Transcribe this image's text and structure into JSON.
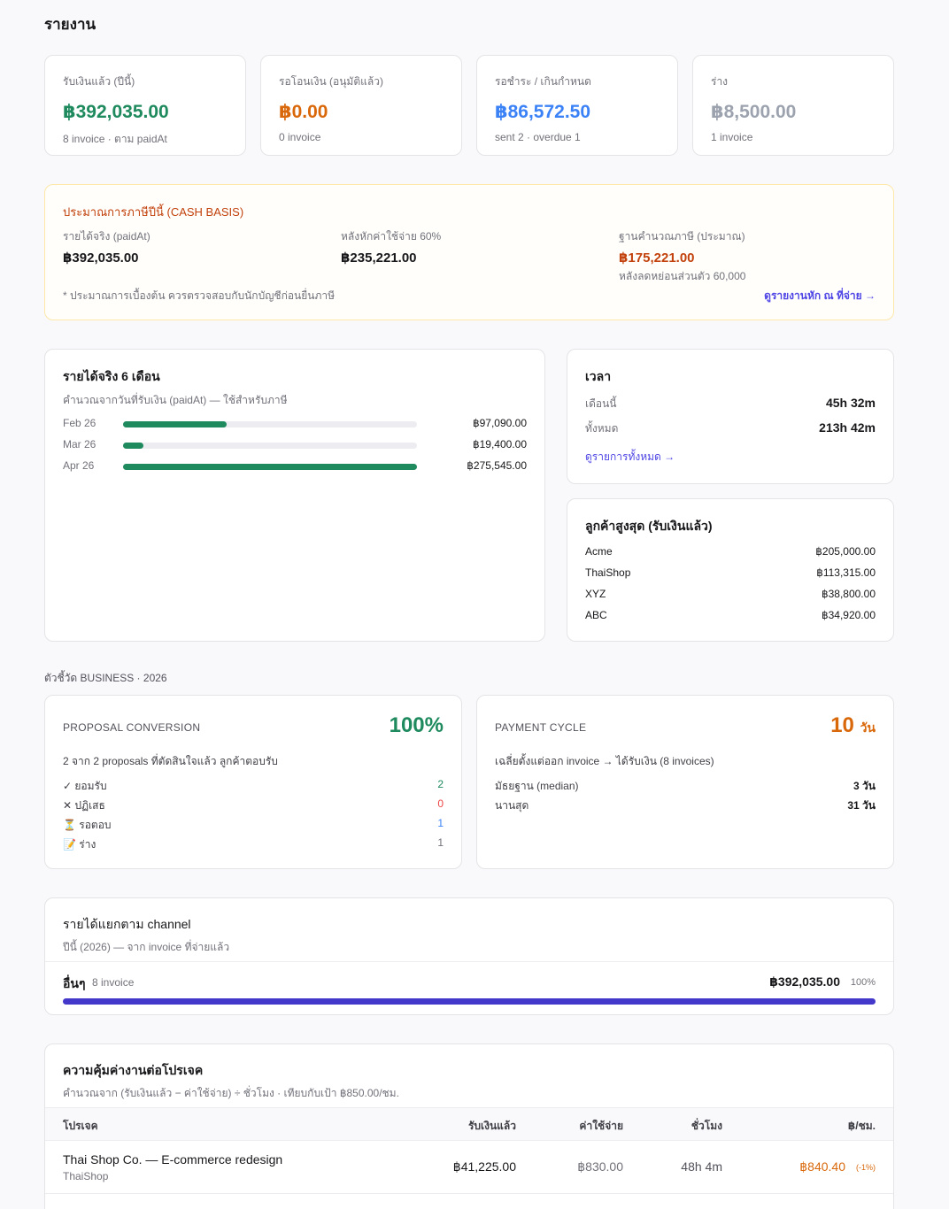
{
  "page_title": "รายงาน",
  "stats": [
    {
      "label": "รับเงินแล้ว (ปีนี้)",
      "value": "฿392,035.00",
      "sub": "8 invoice · ตาม paidAt",
      "color": "#1e8a5e"
    },
    {
      "label": "รอโอนเงิน (อนุมัติแล้ว)",
      "value": "฿0.00",
      "sub": "0 invoice",
      "color": "#d9680b"
    },
    {
      "label": "รอชำระ / เกินกำหนด",
      "value": "฿86,572.50",
      "sub": "sent 2 · overdue 1",
      "color": "#3b82f6"
    },
    {
      "label": "ร่าง",
      "value": "฿8,500.00",
      "sub": "1 invoice",
      "color": "#9ca3af"
    }
  ],
  "tax": {
    "title": "ประมาณการภาษีปีนี้ (CASH BASIS)",
    "income_label": "รายได้จริง (paidAt)",
    "income_value": "฿392,035.00",
    "after_expense_label": "หลังหักค่าใช้จ่าย 60%",
    "after_expense_value": "฿235,221.00",
    "base_label": "ฐานคำนวณภาษี (ประมาณ)",
    "base_value": "฿175,221.00",
    "base_sub": "หลังลดหย่อนส่วนตัว 60,000",
    "note": "* ประมาณการเบื้องต้น ควรตรวจสอบกับนักบัญชีก่อนยื่นภาษี",
    "link": "ดูรายงานหัก ณ ที่จ่าย →"
  },
  "income6": {
    "title": "รายได้จริง 6 เดือน",
    "subtitle": "คำนวณจากวันที่รับเงิน (paidAt) — ใช้สำหรับภาษี",
    "rows": [
      {
        "month": "Feb 26",
        "amount": "฿97,090.00",
        "fraction": 0.352
      },
      {
        "month": "Mar 26",
        "amount": "฿19,400.00",
        "fraction": 0.07
      },
      {
        "month": "Apr 26",
        "amount": "฿275,545.00",
        "fraction": 1.0
      }
    ]
  },
  "time": {
    "title": "เวลา",
    "this_month_label": "เดือนนี้",
    "this_month_value": "45h 32m",
    "total_label": "ทั้งหมด",
    "total_value": "213h 42m",
    "link": "ดูรายการทั้งหมด →"
  },
  "clients": {
    "title": "ลูกค้าสูงสุด (รับเงินแล้ว)",
    "rows": [
      {
        "name": "Acme",
        "amount": "฿205,000.00"
      },
      {
        "name": "ThaiShop",
        "amount": "฿113,315.00"
      },
      {
        "name": "XYZ",
        "amount": "฿38,800.00"
      },
      {
        "name": "ABC",
        "amount": "฿34,920.00"
      }
    ]
  },
  "metrics_label": "ตัวชี้วัด BUSINESS · 2026",
  "proposal": {
    "title": "PROPOSAL CONVERSION",
    "value": "100%",
    "desc": "2 จาก 2 proposals ที่ตัดสินใจแล้ว ลูกค้าตอบรับ",
    "rows": [
      {
        "label": "✓ ยอมรับ",
        "value": "2",
        "color": "#1e8a5e"
      },
      {
        "label": "✕ ปฏิเสธ",
        "value": "0",
        "color": "#ef4444"
      },
      {
        "label": "⏳ รอตอบ",
        "value": "1",
        "color": "#3b82f6"
      },
      {
        "label": "📝 ร่าง",
        "value": "1",
        "color": "#71717a"
      }
    ]
  },
  "payment": {
    "title": "PAYMENT CYCLE",
    "value": "10",
    "unit": "วัน",
    "desc": "เฉลี่ยตั้งแต่ออก invoice → ได้รับเงิน (8 invoices)",
    "median_label": "มัธยฐาน (median)",
    "median_value": "3 วัน",
    "max_label": "นานสุด",
    "max_value": "31 วัน"
  },
  "channel": {
    "title": "รายได้แยกตาม channel",
    "subtitle": "ปีนี้ (2026) — จาก invoice ที่จ่ายแล้ว",
    "name": "อื่นๆ",
    "count": "8 invoice",
    "amount": "฿392,035.00",
    "pct": "100%",
    "fraction": 1.0
  },
  "value_table": {
    "title": "ความคุ้มค่างานต่อโปรเจค",
    "subtitle": "คำนวณจาก (รับเงินแล้ว − ค่าใช้จ่าย) ÷ ชั่วโมง · เทียบกับเป้า ฿850.00/ชม.",
    "headers": [
      "โปรเจค",
      "รับเงินแล้ว",
      "ค่าใช้จ่าย",
      "ชั่วโมง",
      "฿/ชม."
    ],
    "rows": [
      {
        "project": "Thai Shop Co. — E-commerce redesign",
        "client": "ThaiShop",
        "received": "฿41,225.00",
        "expense": "฿830.00",
        "hours": "48h 4m",
        "rate": "฿840.40",
        "delta": "(-1%)"
      }
    ]
  }
}
